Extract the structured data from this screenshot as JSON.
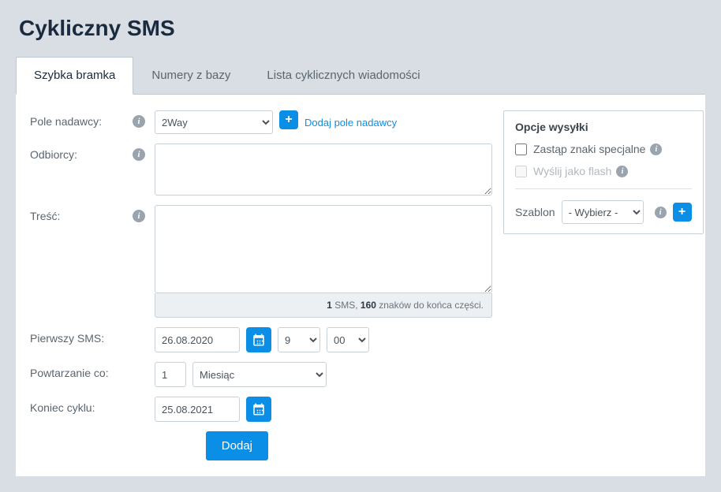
{
  "pageTitle": "Cykliczny SMS",
  "tabs": [
    {
      "label": "Szybka bramka",
      "active": true
    },
    {
      "label": "Numery z bazy",
      "active": false
    },
    {
      "label": "Lista cyklicznych wiadomości",
      "active": false
    }
  ],
  "labels": {
    "senderField": "Pole nadawcy:",
    "recipients": "Odbiorcy:",
    "content": "Treść:",
    "firstSms": "Pierwszy SMS:",
    "repeatEvery": "Powtarzanie co:",
    "cycleEnd": "Koniec cyklu:"
  },
  "sender": {
    "value": "2Way",
    "addLinkText": "Dodaj pole nadawcy"
  },
  "recipients": "",
  "content": "",
  "counter": {
    "smsCount": "1",
    "smsLabel": " SMS, ",
    "charsLeft": "160",
    "charsSuffix": " znaków do końca części."
  },
  "firstSms": {
    "date": "26.08.2020",
    "hour": "9",
    "minute": "00"
  },
  "repeat": {
    "value": "1",
    "unit": "Miesiąc"
  },
  "cycleEnd": {
    "date": "25.08.2021"
  },
  "options": {
    "title": "Opcje wysyłki",
    "replaceSpecialLabel": "Zastąp znaki specjalne",
    "sendAsFlashLabel": "Wyślij jako flash",
    "templateLabel": "Szablon",
    "templateValue": "- Wybierz -"
  },
  "submitLabel": "Dodaj"
}
